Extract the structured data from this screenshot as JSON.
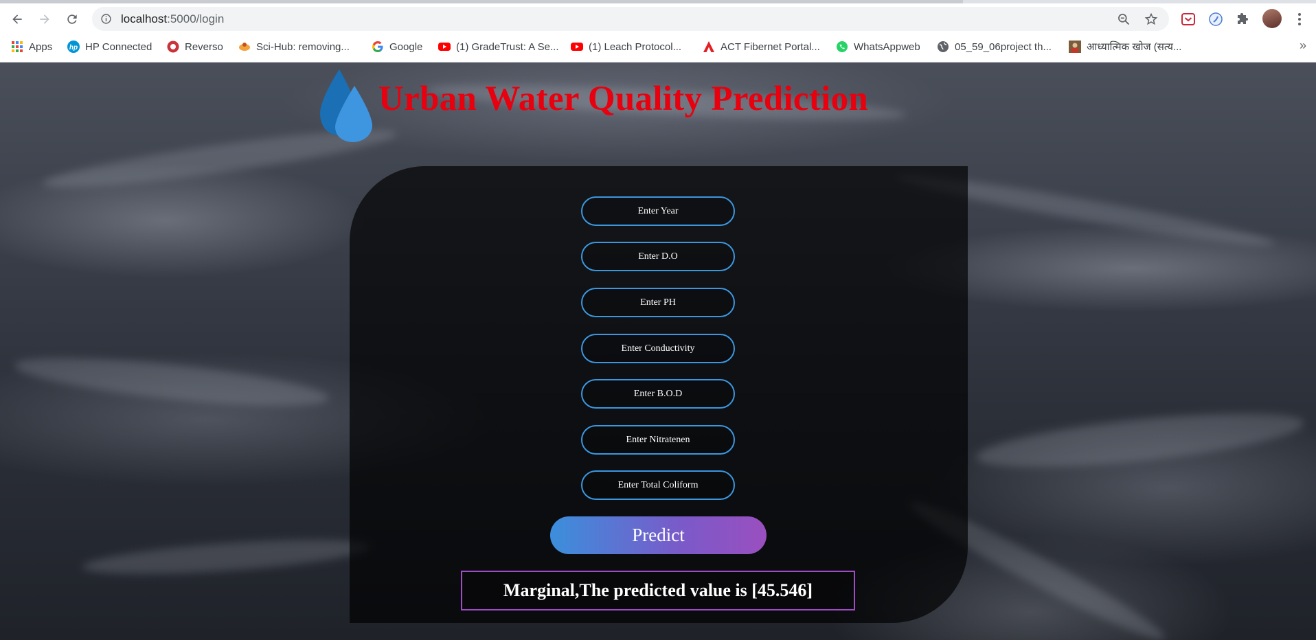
{
  "browser": {
    "url_host": "localhost",
    "url_path": ":5000/login",
    "bookmarks": [
      {
        "label": "Apps",
        "icon": "apps-grid-icon"
      },
      {
        "label": "HP Connected",
        "icon": "hp-logo-icon"
      },
      {
        "label": "Reverso",
        "icon": "reverso-logo-icon"
      },
      {
        "label": "Sci-Hub: removing...",
        "icon": "scihub-logo-icon"
      },
      {
        "label": "Google",
        "icon": "google-logo-icon"
      },
      {
        "label": "(1) GradeTrust: A Se...",
        "icon": "youtube-logo-icon"
      },
      {
        "label": "(1) Leach Protocol...",
        "icon": "youtube-logo-icon"
      },
      {
        "label": "ACT Fibernet Portal...",
        "icon": "act-logo-icon"
      },
      {
        "label": "WhatsAppweb",
        "icon": "whatsapp-logo-icon"
      },
      {
        "label": "05_59_06project th...",
        "icon": "globe-icon"
      },
      {
        "label": "आध्यात्मिक खोज (सत्य...",
        "icon": "profile-thumbnail-icon"
      }
    ],
    "more_label": "»"
  },
  "page": {
    "title": "Urban Water Quality Prediction",
    "fields": [
      {
        "placeholder": "Enter Year"
      },
      {
        "placeholder": "Enter D.O"
      },
      {
        "placeholder": "Enter PH"
      },
      {
        "placeholder": "Enter Conductivity"
      },
      {
        "placeholder": "Enter B.O.D"
      },
      {
        "placeholder": "Enter Nitratenen"
      },
      {
        "placeholder": "Enter Total Coliform"
      }
    ],
    "predict_label": "Predict",
    "result_text": "Marginal,The predicted value is [45.546]"
  },
  "colors": {
    "title": "#e8000f",
    "field_border": "#3b97e0",
    "result_border": "#a24bc9"
  }
}
